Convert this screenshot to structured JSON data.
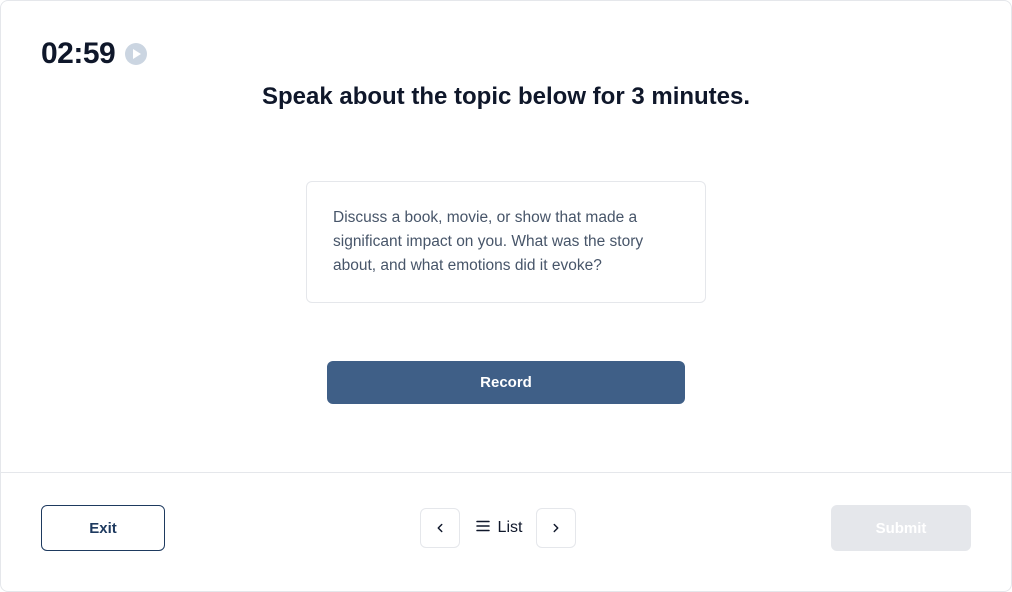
{
  "timer": "02:59",
  "instruction": "Speak about the topic below for 3 minutes.",
  "prompt": "Discuss a book, movie, or show that made a significant impact on you. What was the story about, and what emotions did it evoke?",
  "record_label": "Record",
  "footer": {
    "exit_label": "Exit",
    "list_label": "List",
    "submit_label": "Submit"
  }
}
